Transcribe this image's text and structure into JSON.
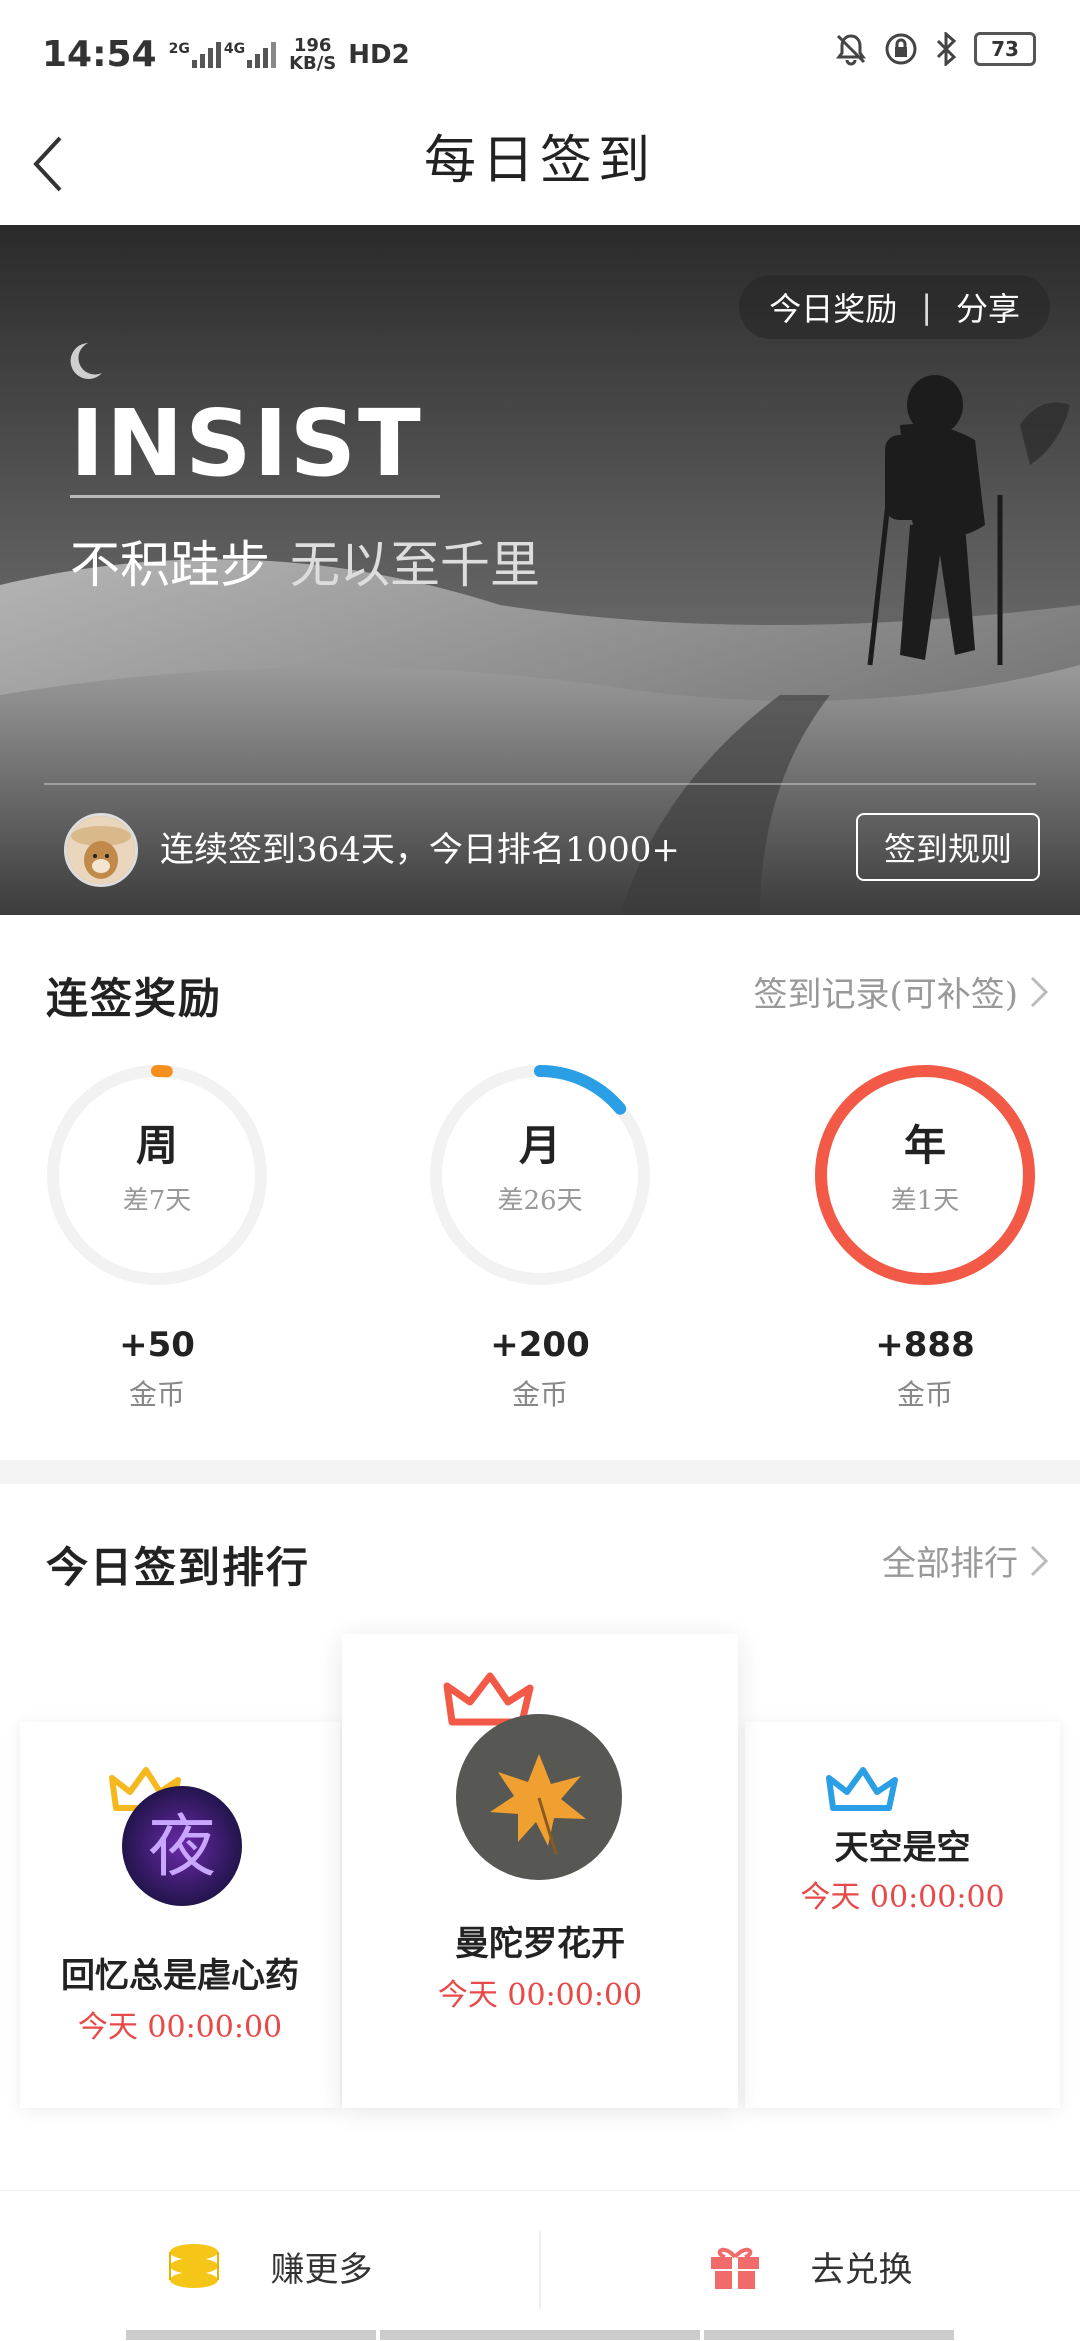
{
  "status_bar": {
    "time": "14:54",
    "signal_1": "2G",
    "signal_2": "4G",
    "net_speed_value": "196",
    "net_speed_unit": "KB/S",
    "hd_label": "HD2",
    "battery": "73"
  },
  "header": {
    "title": "每日签到"
  },
  "banner": {
    "today_reward": "今日奖励",
    "separator": "|",
    "share": "分享",
    "headline": "INSIST",
    "quote_part1": "不积跬步",
    "quote_part2": "无以至千里",
    "status_text": "连续签到364天，今日排名1000+",
    "rules_button": "签到规则"
  },
  "streak": {
    "title": "连签奖励",
    "record_link": "签到记录(可补签)",
    "items": [
      {
        "name": "周",
        "diff": "差7天",
        "reward": "+50",
        "unit": "金币",
        "progress": 0.0,
        "color": "#f5901e"
      },
      {
        "name": "月",
        "diff": "差26天",
        "reward": "+200",
        "unit": "金币",
        "progress": 0.14,
        "color": "#2a9fe6"
      },
      {
        "name": "年",
        "diff": "差1天",
        "reward": "+888",
        "unit": "金币",
        "progress": 1.0,
        "color": "#f25a47"
      }
    ]
  },
  "ranking": {
    "title": "今日签到排行",
    "all_link": "全部排行",
    "first": {
      "name": "曼陀罗花开",
      "time": "今天 00:00:00",
      "crown_color": "#f25a47"
    },
    "second": {
      "name": "回忆总是虐心药",
      "time": "今天 00:00:00",
      "crown_color": "#f5b81e"
    },
    "third": {
      "name": "天空是空",
      "time": "今天 00:00:00",
      "crown_color": "#2a9fe6"
    }
  },
  "bottom": {
    "earn_more": "赚更多",
    "redeem": "去兑换",
    "coin_color": "#f5c518",
    "gift_color": "#f26b6b"
  }
}
